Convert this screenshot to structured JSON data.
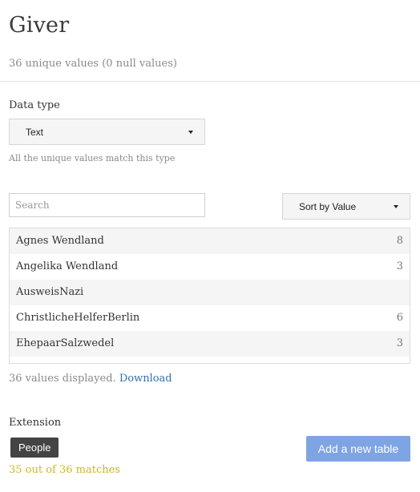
{
  "header": {
    "title": "Giver",
    "subtitle": "36 unique values (0 null values)"
  },
  "data_type": {
    "label": "Data type",
    "selected": "Text",
    "hint": "All the unique values match this type"
  },
  "search": {
    "placeholder": "Search",
    "value": ""
  },
  "sort": {
    "selected": "Sort by Value"
  },
  "values": [
    {
      "name": "Agnes Wendland",
      "count": "8"
    },
    {
      "name": "Angelika Wendland",
      "count": "3"
    },
    {
      "name": "AusweisNazi",
      "count": ""
    },
    {
      "name": "ChristlicheHelferBerlin",
      "count": "6"
    },
    {
      "name": "EhepaarSalzwedel",
      "count": "3"
    }
  ],
  "footer": {
    "displayed_text": "36 values displayed.",
    "download_label": "Download"
  },
  "extension": {
    "label": "Extension",
    "chip_label": "People",
    "add_table_label": "Add a new table",
    "matches_text": "35 out of 36 matches",
    "matches_color": "#c9b824",
    "add_button_color": "#7fa4e3"
  }
}
